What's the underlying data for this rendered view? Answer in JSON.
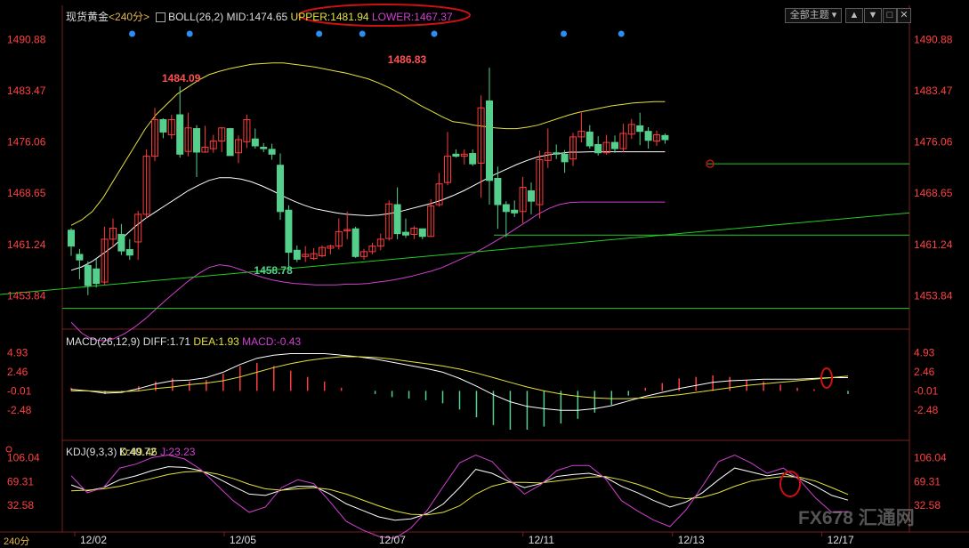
{
  "header": {
    "title": "现货黄金",
    "period": "<240分>",
    "indicator": "BOLL(26,2)",
    "mid": "MID:1474.65",
    "upper": "UPPER:1481.94",
    "lower": "LOWER:1467.37",
    "main_menu": "全部主题",
    "period_tag": "240分"
  },
  "macd_header": {
    "name": "MACD(26,12,9)",
    "diff": "DIFF:1.71",
    "dea": "DEA:1.93",
    "macd": "MACD:-0.43"
  },
  "kdj_header": {
    "name": "KDJ(9,3,3)",
    "k": "K:40.72",
    "d": "D:49.46",
    "j": "J:23.23"
  },
  "watermark": "FX678 汇通网",
  "colors": {
    "up": "#ff3b3b",
    "down": "#55d08c",
    "upper_band": "#e6e23b",
    "mid_band": "#ffffff",
    "lower_band": "#d040d0",
    "trendline": "#22cc22",
    "axis_text": "#ff4040",
    "annotation": "#cc1111"
  },
  "chart_data": [
    {
      "type": "candlestick",
      "title": "现货黄金 240分",
      "y_ticks": [
        1490.88,
        1483.47,
        1476.06,
        1468.65,
        1461.24,
        1453.84
      ],
      "ylim": [
        1449.5,
        1493.0
      ],
      "x_ticks": [
        "12/02",
        "12/05",
        "12/07",
        "12/11",
        "12/13",
        "12/17"
      ],
      "x_tick_index": [
        1,
        13,
        21,
        30,
        38,
        46
      ],
      "price_labels": [
        {
          "text": "1484.09",
          "index": 10,
          "value": 1484.09
        },
        {
          "text": "1486.83",
          "index": 37,
          "value": 1486.83
        },
        {
          "text": "1458.78",
          "index": 21,
          "value": 1458.78
        }
      ],
      "signal_dots": [
        3,
        7,
        16,
        19,
        24,
        33,
        37
      ],
      "candles": [
        [
          1463.3,
          1461.0,
          1459.6,
          1463.6
        ],
        [
          1459.8,
          1459.0,
          1456.2,
          1460.6
        ],
        [
          1458.2,
          1455.3,
          1453.9,
          1458.8
        ],
        [
          1457.7,
          1455.6,
          1455.0,
          1459.2
        ],
        [
          1455.8,
          1462.0,
          1455.4,
          1463.8
        ],
        [
          1462.0,
          1463.6,
          1460.8,
          1465.0
        ],
        [
          1462.7,
          1460.3,
          1459.7,
          1464.2
        ],
        [
          1460.5,
          1459.7,
          1459.0,
          1462.0
        ],
        [
          1461.6,
          1465.6,
          1459.0,
          1466.1
        ],
        [
          1465.6,
          1474.0,
          1465.0,
          1475.0
        ],
        [
          1474.0,
          1479.3,
          1473.3,
          1481.0
        ],
        [
          1479.3,
          1477.5,
          1476.6,
          1479.5
        ],
        [
          1477.1,
          1479.3,
          1476.5,
          1480.0
        ],
        [
          1480.0,
          1474.3,
          1473.8,
          1484.1
        ],
        [
          1474.7,
          1478.1,
          1474.0,
          1480.3
        ],
        [
          1478.0,
          1474.6,
          1471.0,
          1478.5
        ],
        [
          1474.6,
          1475.3,
          1474.5,
          1478.4
        ],
        [
          1475.1,
          1476.2,
          1474.5,
          1477.1
        ],
        [
          1476.2,
          1478.1,
          1474.6,
          1478.2
        ],
        [
          1478.0,
          1474.1,
          1474.1,
          1478.1
        ],
        [
          1474.5,
          1476.4,
          1473.0,
          1477.0
        ],
        [
          1476.1,
          1479.3,
          1475.2,
          1480.0
        ],
        [
          1476.5,
          1475.5,
          1475.1,
          1478.0
        ],
        [
          1475.3,
          1475.1,
          1474.6,
          1475.9
        ],
        [
          1475.0,
          1474.3,
          1473.5,
          1475.8
        ],
        [
          1472.7,
          1466.0,
          1464.8,
          1474.4
        ],
        [
          1466.2,
          1460.1,
          1457.6,
          1466.9
        ],
        [
          1460.4,
          1459.1,
          1458.7,
          1461.1
        ],
        [
          1459.5,
          1459.8,
          1458.7,
          1461.0
        ],
        [
          1459.2,
          1459.9,
          1459.0,
          1460.7
        ],
        [
          1459.6,
          1460.8,
          1459.4,
          1461.1
        ],
        [
          1460.7,
          1461.0,
          1459.8,
          1461.2
        ],
        [
          1461.0,
          1463.1,
          1460.5,
          1465.0
        ],
        [
          1463.2,
          1463.4,
          1462.0,
          1466.0
        ],
        [
          1463.5,
          1459.5,
          1459.3,
          1463.8
        ],
        [
          1459.5,
          1460.2,
          1459.0,
          1460.6
        ],
        [
          1460.2,
          1461.0,
          1459.8,
          1461.5
        ],
        [
          1461.0,
          1462.0,
          1460.4,
          1462.8
        ],
        [
          1462.1,
          1467.1,
          1461.8,
          1467.6
        ],
        [
          1467.0,
          1462.8,
          1462.0,
          1469.5
        ],
        [
          1463.0,
          1462.6,
          1462.2,
          1465.0
        ],
        [
          1462.7,
          1463.6,
          1462.0,
          1463.9
        ],
        [
          1463.5,
          1462.4,
          1462.0,
          1463.5
        ],
        [
          1462.4,
          1466.8,
          1462.3,
          1467.8
        ],
        [
          1467.0,
          1470.0,
          1466.7,
          1471.6
        ],
        [
          1470.2,
          1474.0,
          1469.8,
          1477.5
        ],
        [
          1474.3,
          1474.0,
          1473.8,
          1475.0
        ],
        [
          1474.0,
          1474.3,
          1472.8,
          1475.0
        ],
        [
          1474.4,
          1472.9,
          1472.6,
          1475.0
        ],
        [
          1473.0,
          1481.0,
          1468.0,
          1482.8
        ],
        [
          1482.0,
          1470.5,
          1467.0,
          1486.8
        ],
        [
          1470.8,
          1467.0,
          1463.5,
          1472.5
        ],
        [
          1467.0,
          1466.0,
          1462.3,
          1467.5
        ],
        [
          1466.2,
          1465.8,
          1465.2,
          1467.6
        ],
        [
          1466.0,
          1469.5,
          1464.3,
          1471.0
        ],
        [
          1469.0,
          1467.5,
          1465.6,
          1470.2
        ],
        [
          1467.0,
          1473.5,
          1465.0,
          1474.8
        ],
        [
          1473.4,
          1474.5,
          1472.3,
          1478.0
        ],
        [
          1474.5,
          1474.3,
          1473.6,
          1475.7
        ],
        [
          1474.3,
          1473.2,
          1471.6,
          1474.9
        ],
        [
          1473.6,
          1476.8,
          1472.6,
          1477.4
        ],
        [
          1476.8,
          1477.6,
          1476.0,
          1480.5
        ],
        [
          1477.5,
          1475.5,
          1475.1,
          1478.5
        ],
        [
          1475.7,
          1474.5,
          1474.1,
          1476.9
        ],
        [
          1474.5,
          1476.0,
          1474.2,
          1477.1
        ],
        [
          1476.0,
          1475.1,
          1474.5,
          1477.0
        ],
        [
          1475.1,
          1477.3,
          1474.6,
          1478.7
        ],
        [
          1477.2,
          1478.6,
          1476.5,
          1479.4
        ],
        [
          1478.4,
          1477.6,
          1475.6,
          1480.3
        ],
        [
          1477.6,
          1476.3,
          1475.1,
          1478.2
        ],
        [
          1476.2,
          1477.1,
          1475.5,
          1477.7
        ],
        [
          1477.0,
          1476.4,
          1475.8,
          1477.3
        ]
      ],
      "bands": {
        "upper": [
          1464.0,
          1464.8,
          1466.0,
          1468.0,
          1470.5,
          1473.0,
          1475.5,
          1478.0,
          1480.0,
          1481.5,
          1483.0,
          1484.0,
          1485.0,
          1485.8,
          1486.3,
          1486.7,
          1487.0,
          1487.3,
          1487.4,
          1487.5,
          1487.5,
          1487.3,
          1487.1,
          1486.9,
          1486.6,
          1486.3,
          1486.0,
          1485.6,
          1485.2,
          1484.6,
          1483.9,
          1483.1,
          1482.2,
          1481.3,
          1480.5,
          1479.7,
          1479.0,
          1478.8,
          1478.5,
          1478.3,
          1478.1,
          1478.0,
          1478.0,
          1478.2,
          1478.5,
          1479.0,
          1479.5,
          1480.0,
          1480.4,
          1480.7,
          1481.0,
          1481.3,
          1481.5,
          1481.7,
          1481.8,
          1481.9,
          1481.9
        ],
        "mid": [
          1457.5,
          1458.0,
          1458.8,
          1459.9,
          1461.0,
          1462.4,
          1463.8,
          1465.0,
          1466.0,
          1467.0,
          1468.0,
          1469.0,
          1469.8,
          1470.5,
          1470.9,
          1470.9,
          1470.7,
          1470.3,
          1469.7,
          1469.0,
          1468.2,
          1467.5,
          1466.9,
          1466.4,
          1466.1,
          1465.8,
          1465.6,
          1465.5,
          1465.4,
          1465.5,
          1465.7,
          1466.0,
          1466.4,
          1466.8,
          1467.2,
          1467.7,
          1468.3,
          1469.0,
          1469.8,
          1470.6,
          1471.4,
          1472.1,
          1472.8,
          1473.4,
          1473.9,
          1474.2,
          1474.4,
          1474.6,
          1474.6,
          1474.65,
          1474.65,
          1474.65,
          1474.65,
          1474.65,
          1474.65,
          1474.65,
          1474.65
        ],
        "lower": [
          1450.0,
          1448.4,
          1447.5,
          1447.3,
          1447.6,
          1448.3,
          1449.3,
          1450.5,
          1451.9,
          1453.3,
          1454.6,
          1455.9,
          1457.0,
          1457.9,
          1458.3,
          1458.1,
          1457.6,
          1457.0,
          1456.5,
          1456.1,
          1455.8,
          1455.6,
          1455.5,
          1455.4,
          1455.4,
          1455.4,
          1455.5,
          1455.5,
          1455.6,
          1455.8,
          1456.0,
          1456.3,
          1456.6,
          1457.0,
          1457.4,
          1457.9,
          1458.6,
          1459.3,
          1460.0,
          1460.8,
          1461.7,
          1462.6,
          1463.6,
          1464.6,
          1465.6,
          1466.4,
          1467.0,
          1467.3,
          1467.37,
          1467.37,
          1467.37,
          1467.37,
          1467.37,
          1467.37,
          1467.37,
          1467.37,
          1467.37
        ]
      }
    },
    {
      "type": "bar",
      "title": "MACD(26,12,9)",
      "y_ticks": [
        4.93,
        2.46,
        -0.01,
        -2.48
      ],
      "ylim": [
        -5.8,
        6.0
      ],
      "series": [
        {
          "name": "DIFF",
          "values": [
            0.2,
            0.0,
            -0.3,
            -0.2,
            0.3,
            0.9,
            1.3,
            1.4,
            1.7,
            2.4,
            3.4,
            4.2,
            4.6,
            4.8,
            4.8,
            4.8,
            4.6,
            4.4,
            4.1,
            3.7,
            3.3,
            2.9,
            2.4,
            1.6,
            0.6,
            -0.5,
            -1.4,
            -2.0,
            -2.3,
            -2.5,
            -2.5,
            -2.3,
            -1.9,
            -1.3,
            -0.7,
            -0.2,
            0.3,
            0.7,
            1.1,
            1.3,
            1.4,
            1.5,
            1.5,
            1.5,
            1.6,
            1.7,
            1.7
          ]
        },
        {
          "name": "DEA",
          "values": [
            0.0,
            0.0,
            -0.1,
            -0.1,
            0.0,
            0.3,
            0.5,
            0.8,
            1.0,
            1.3,
            1.8,
            2.4,
            3.0,
            3.5,
            3.9,
            4.2,
            4.4,
            4.4,
            4.3,
            4.1,
            3.8,
            3.5,
            3.2,
            2.8,
            2.3,
            1.7,
            1.1,
            0.5,
            0.0,
            -0.4,
            -0.7,
            -0.9,
            -1.0,
            -1.0,
            -0.9,
            -0.7,
            -0.5,
            -0.2,
            0.1,
            0.4,
            0.7,
            0.9,
            1.1,
            1.3,
            1.5,
            1.7,
            1.9
          ]
        }
      ]
    },
    {
      "type": "line",
      "title": "KDJ(9,3,3)",
      "y_ticks": [
        106.04,
        69.31,
        32.58
      ],
      "ylim": [
        0,
        112.0
      ],
      "series": [
        {
          "name": "K",
          "values": [
            64,
            55,
            60,
            72,
            78,
            86,
            92,
            91,
            86,
            75,
            62,
            50,
            48,
            56,
            62,
            62,
            50,
            35,
            25,
            15,
            10,
            12,
            20,
            35,
            60,
            88,
            82,
            70,
            60,
            66,
            77,
            80,
            82,
            76,
            62,
            52,
            40,
            30,
            38,
            52,
            72,
            90,
            84,
            78,
            82,
            74,
            62,
            48,
            40.72
          ]
        },
        {
          "name": "D",
          "values": [
            55,
            56,
            58,
            62,
            68,
            74,
            80,
            84,
            85,
            81,
            74,
            65,
            58,
            56,
            58,
            60,
            57,
            50,
            41,
            32,
            24,
            19,
            18,
            22,
            32,
            50,
            62,
            68,
            68,
            67,
            70,
            73,
            76,
            77,
            72,
            65,
            56,
            46,
            43,
            45,
            52,
            62,
            70,
            74,
            77,
            76,
            70,
            60,
            49.46
          ]
        },
        {
          "name": "J",
          "values": [
            78,
            52,
            60,
            90,
            96,
            106,
            110,
            104,
            88,
            64,
            40,
            22,
            30,
            60,
            72,
            66,
            38,
            8,
            -5,
            -15,
            -18,
            -2,
            25,
            62,
            98,
            110,
            100,
            74,
            50,
            64,
            86,
            94,
            94,
            74,
            40,
            24,
            10,
            0,
            26,
            62,
            100,
            110,
            98,
            82,
            90,
            72,
            44,
            22,
            23.23
          ]
        }
      ]
    }
  ]
}
